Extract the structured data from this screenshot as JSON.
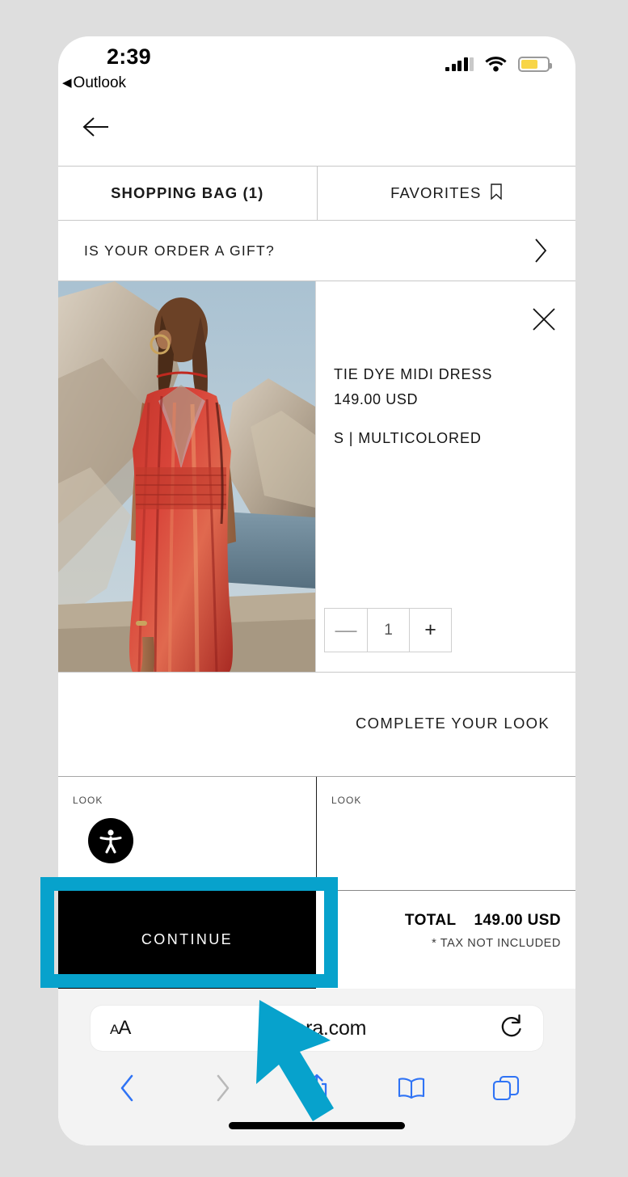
{
  "status_bar": {
    "time": "2:39",
    "back_app_label": "Outlook",
    "back_triangle": "◀",
    "signal_icon": "cellular-signal-icon",
    "wifi_icon": "wifi-icon",
    "battery_icon": "battery-icon",
    "battery_color": "#f8d548",
    "battery_level_percent": 66
  },
  "nav": {
    "back_arrow_icon": "arrow-left-icon"
  },
  "tabs": [
    {
      "label": "SHOPPING BAG (1)",
      "active": true,
      "icon": null
    },
    {
      "label": "FAVORITES",
      "active": false,
      "icon": "bookmark-icon"
    }
  ],
  "gift_row": {
    "label": "IS YOUR ORDER A GIFT?",
    "chevron_icon": "chevron-right-icon"
  },
  "product": {
    "name": "TIE DYE MIDI DRESS",
    "price": "149.00 USD",
    "variant": "S | MULTICOLORED",
    "remove_icon": "close-x-icon",
    "quantity": {
      "decrement_label": "—",
      "value": "1",
      "increment_label": "+"
    },
    "image_alt": "Woman in red tie dye midi dress on rocky coastline"
  },
  "complete_your_look": {
    "title": "COMPLETE YOUR LOOK",
    "items": [
      {
        "label": "LOOK",
        "badge_icon": "accessibility-icon"
      },
      {
        "label": "LOOK",
        "badge_icon": null
      }
    ]
  },
  "checkout": {
    "continue_label": "CONTINUE",
    "total_label": "TOTAL",
    "total_value": "149.00 USD",
    "tax_note": "* TAX NOT INCLUDED"
  },
  "browser": {
    "text_size_label": "AA",
    "lock_icon": "lock-icon",
    "url": "zara.com",
    "reload_icon": "reload-icon",
    "toolbar": [
      {
        "name": "back",
        "icon": "chevron-left-icon",
        "enabled": true
      },
      {
        "name": "forward",
        "icon": "chevron-right-icon",
        "enabled": false
      },
      {
        "name": "share",
        "icon": "share-icon",
        "enabled": true
      },
      {
        "name": "bookmarks",
        "icon": "book-icon",
        "enabled": true
      },
      {
        "name": "tabs",
        "icon": "tabs-icon",
        "enabled": true
      }
    ],
    "accent_color": "#2f73f5"
  },
  "annotation": {
    "highlight_color": "#07a2cc",
    "highlight_target": "CONTINUE",
    "cursor_icon": "arrow-cursor"
  }
}
